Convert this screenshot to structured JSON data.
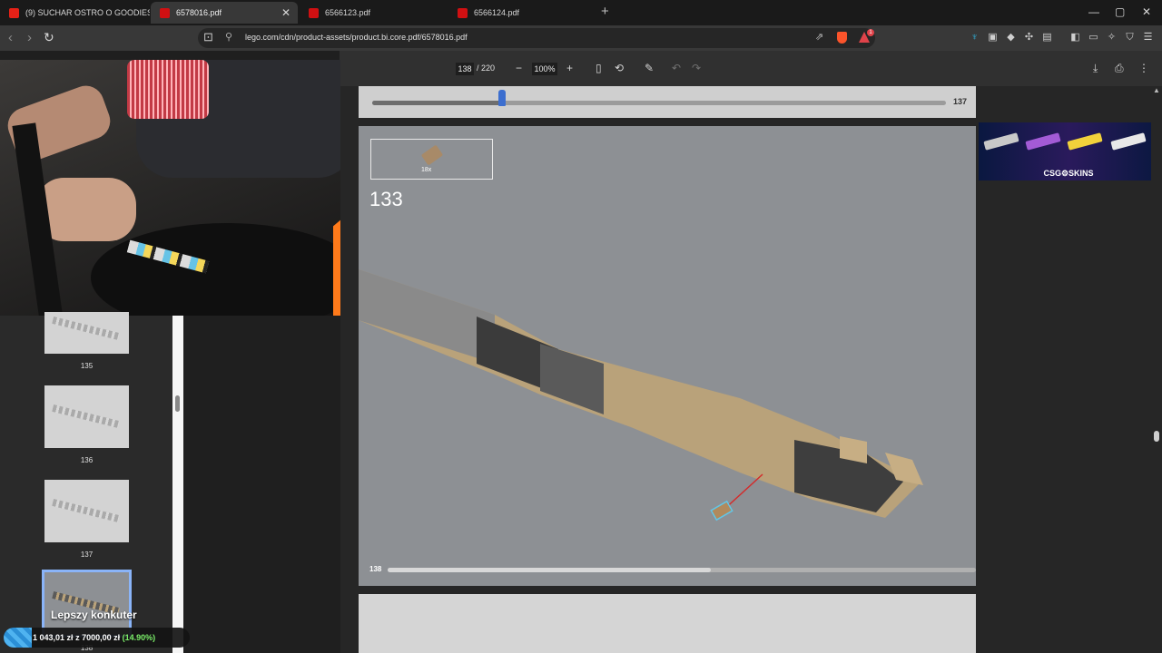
{
  "tabs": [
    {
      "title": "(9) SUCHAR OSTRO O GOODIES! OD",
      "icon": "youtube-icon",
      "active": false
    },
    {
      "title": "6578016.pdf",
      "icon": "lego-icon",
      "active": true
    },
    {
      "title": "6566123.pdf",
      "icon": "lego-icon",
      "active": false
    },
    {
      "title": "6566124.pdf",
      "icon": "lego-icon",
      "active": false
    }
  ],
  "window": {
    "minimize": "—",
    "maximize": "▢",
    "close": "✕",
    "new_tab": "+"
  },
  "address_bar": {
    "url": "lego.com/cdn/product-assets/product.bi.core.pdf/6578016.pdf",
    "rewards_count": "1"
  },
  "pdf_toolbar": {
    "current_page": "138",
    "total_pages": "/ 220",
    "zoom": "100%",
    "zoom_out": "−",
    "zoom_in": "+"
  },
  "sidebar": {
    "thumbnails": [
      {
        "label": "135"
      },
      {
        "label": "136"
      },
      {
        "label": "137"
      },
      {
        "label": "138",
        "selected": true
      }
    ]
  },
  "pdf": {
    "top_page_number": "137",
    "top_page_progress": 0.23,
    "step_number": "133",
    "part_quantity": "18x",
    "page_number": "138",
    "page_progress": 0.55
  },
  "ad": {
    "brand": "CSG⚙SKINS"
  },
  "donation": {
    "title": "Lepszy konkuter",
    "raised": "1 043,01 zł",
    "separator": "z",
    "goal": "7000,00 zł",
    "percent_text": "(14.90%)",
    "fraction": 0.149
  },
  "colors": {
    "accent": "#8ab4f8",
    "brave": "#fb542b",
    "donation_green": "#7cf06a"
  }
}
